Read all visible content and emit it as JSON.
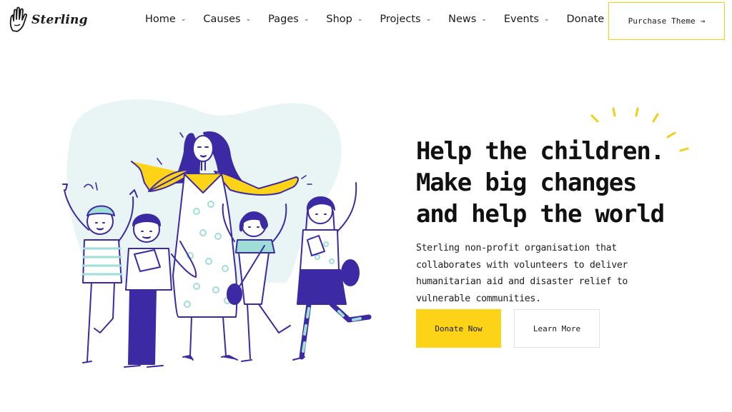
{
  "header": {
    "logo_text": "Sterling",
    "logo_icon": "hand-icon",
    "nav": [
      {
        "label": "Home"
      },
      {
        "label": "Causes"
      },
      {
        "label": "Pages"
      },
      {
        "label": "Shop"
      },
      {
        "label": "Projects"
      },
      {
        "label": "News"
      },
      {
        "label": "Events"
      },
      {
        "label": "Donate"
      }
    ],
    "purchase_label": "Purchase Theme",
    "purchase_arrow": "→"
  },
  "hero": {
    "title_lines": [
      "Help the children.",
      "Make big changes",
      "and help the world"
    ],
    "description": "Sterling non-profit organisation that collaborates with volunteers to deliver humanitarian aid and disaster relief to vulnerable communities.",
    "donate_label": "Donate Now",
    "learn_label": "Learn More",
    "illustration": "children-with-teacher-illustration"
  },
  "colors": {
    "accent": "#fcd317",
    "ink": "#3b2aa3",
    "mint": "#9fded6",
    "blob": "#e8f5f4",
    "text": "#111111"
  }
}
